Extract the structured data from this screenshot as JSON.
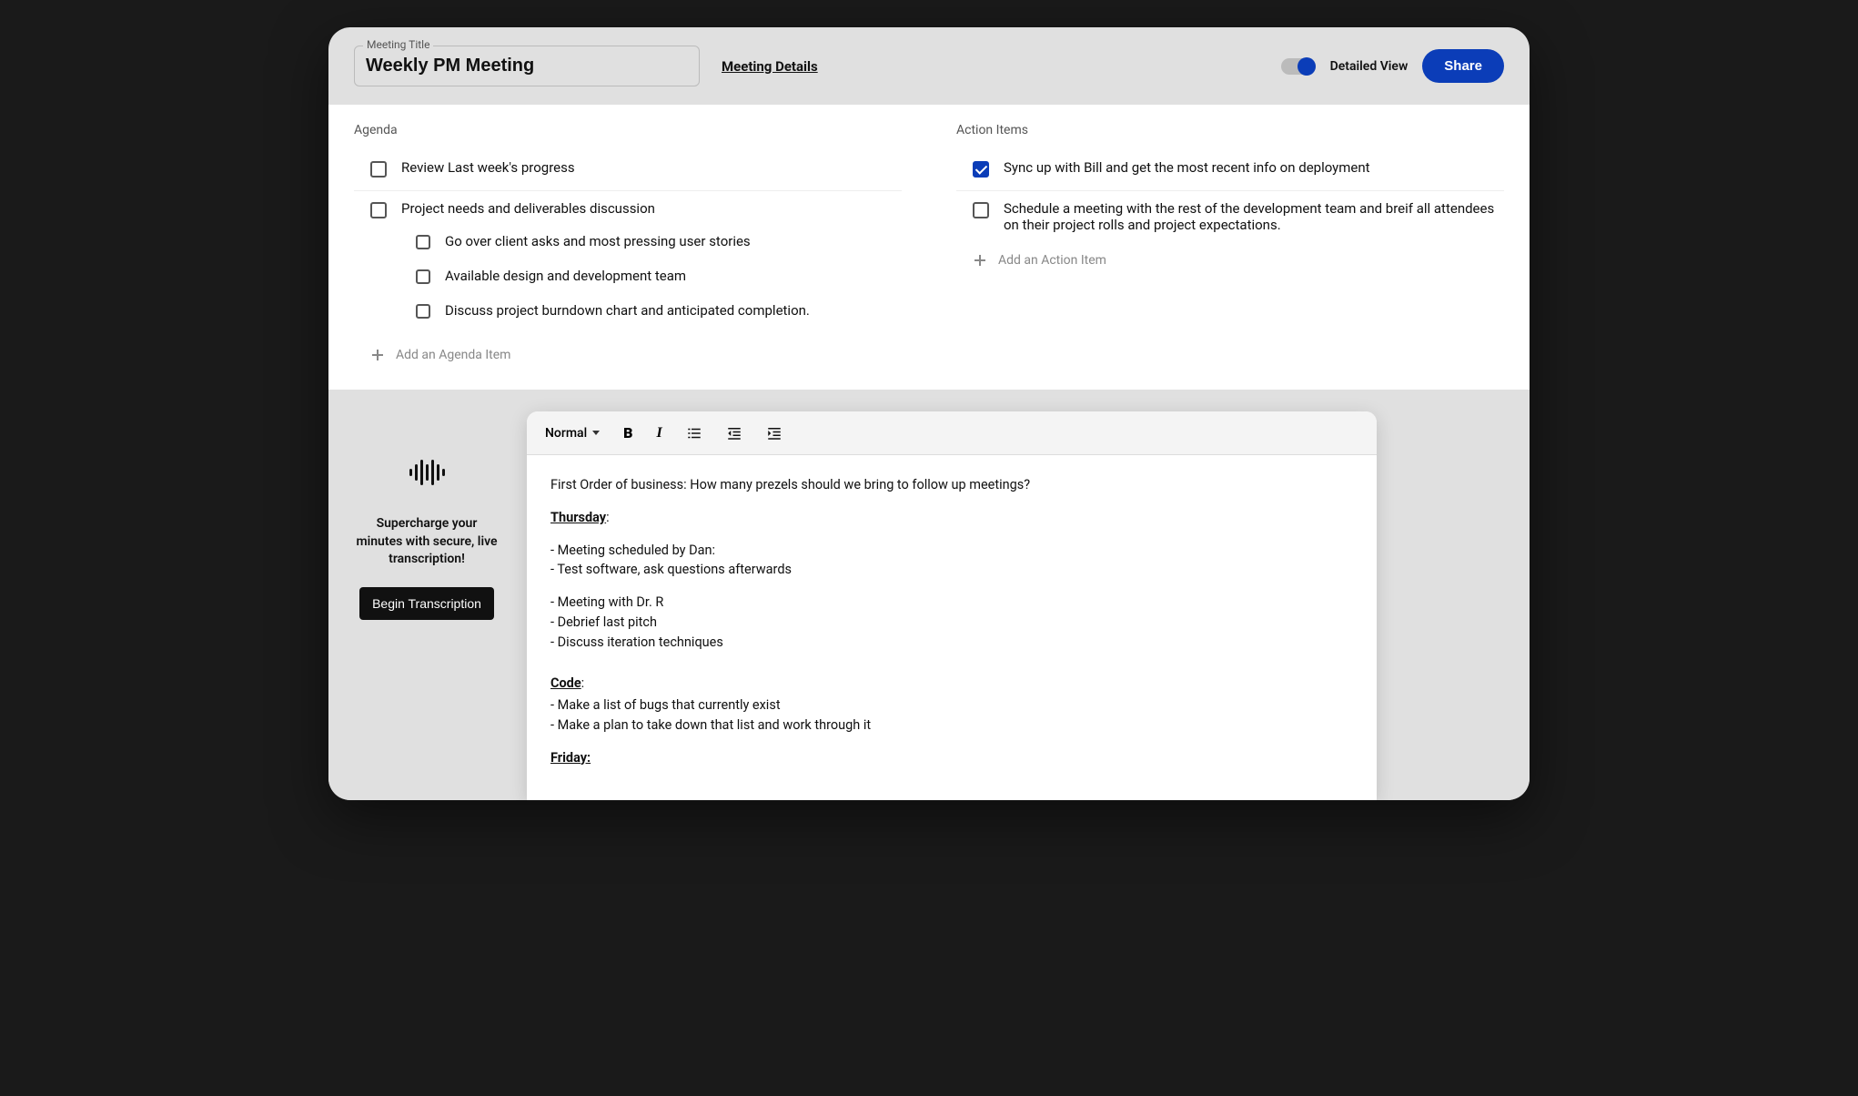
{
  "header": {
    "title_label": "Meeting Title",
    "title_value": "Weekly PM Meeting",
    "details_link": "Meeting Details",
    "detailed_view": "Detailed View",
    "share": "Share"
  },
  "agenda": {
    "title": "Agenda",
    "items": [
      {
        "text": "Review Last week's progress",
        "checked": false
      },
      {
        "text": "Project needs and deliverables discussion",
        "checked": false,
        "sub": [
          "Go over client asks and most pressing user stories",
          "Available design and development team",
          "Discuss project burndown chart and anticipated completion."
        ]
      }
    ],
    "add_label": "Add an Agenda Item"
  },
  "actions": {
    "title": "Action Items",
    "items": [
      {
        "text": "Sync up with Bill and get the most recent info on deployment",
        "checked": true
      },
      {
        "text": "Schedule a meeting with the rest of the development team and breif all attendees on their project rolls and project expectations.",
        "checked": false
      }
    ],
    "add_label": "Add an Action Item"
  },
  "transcription": {
    "promo": "Supercharge your minutes with secure, live transcription!",
    "button": "Begin Transcription"
  },
  "editor": {
    "format_label": "Normal",
    "content": {
      "line1": "First Order of business: How many prezels should we bring to follow up meetings?",
      "h1": "Thursday",
      "thur1": "- Meeting scheduled by Dan:",
      "thur2": "- Test software, ask questions afterwards",
      "thur3": "- Meeting with Dr. R",
      "thur4": "- Debrief last pitch",
      "thur5": "- Discuss iteration techniques",
      "h2": "Code",
      "code1": "- Make a list of bugs that currently exist",
      "code2": "- Make a plan to take down that list and work through it",
      "h3": "Friday:"
    }
  }
}
